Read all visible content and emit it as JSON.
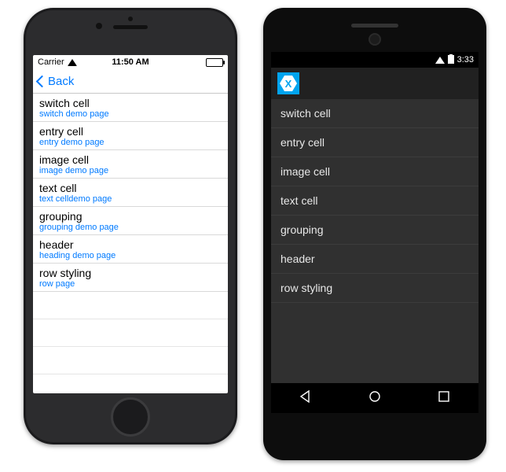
{
  "ios": {
    "status": {
      "carrier": "Carrier",
      "time": "11:50 AM"
    },
    "nav": {
      "back": "Back"
    },
    "cells": [
      {
        "title": "switch cell",
        "sub": "switch demo page"
      },
      {
        "title": "entry cell",
        "sub": "entry demo page"
      },
      {
        "title": "image cell",
        "sub": "image demo page"
      },
      {
        "title": "text cell",
        "sub": "text celldemo page"
      },
      {
        "title": "grouping",
        "sub": "grouping demo page"
      },
      {
        "title": "header",
        "sub": "heading demo page"
      },
      {
        "title": "row styling",
        "sub": "row page"
      }
    ]
  },
  "android": {
    "status": {
      "time": "3:33"
    },
    "logo_glyph": "✕",
    "cells": [
      {
        "title": "switch cell"
      },
      {
        "title": "entry cell"
      },
      {
        "title": "image cell"
      },
      {
        "title": "text cell"
      },
      {
        "title": "grouping"
      },
      {
        "title": "header"
      },
      {
        "title": "row styling"
      }
    ]
  }
}
